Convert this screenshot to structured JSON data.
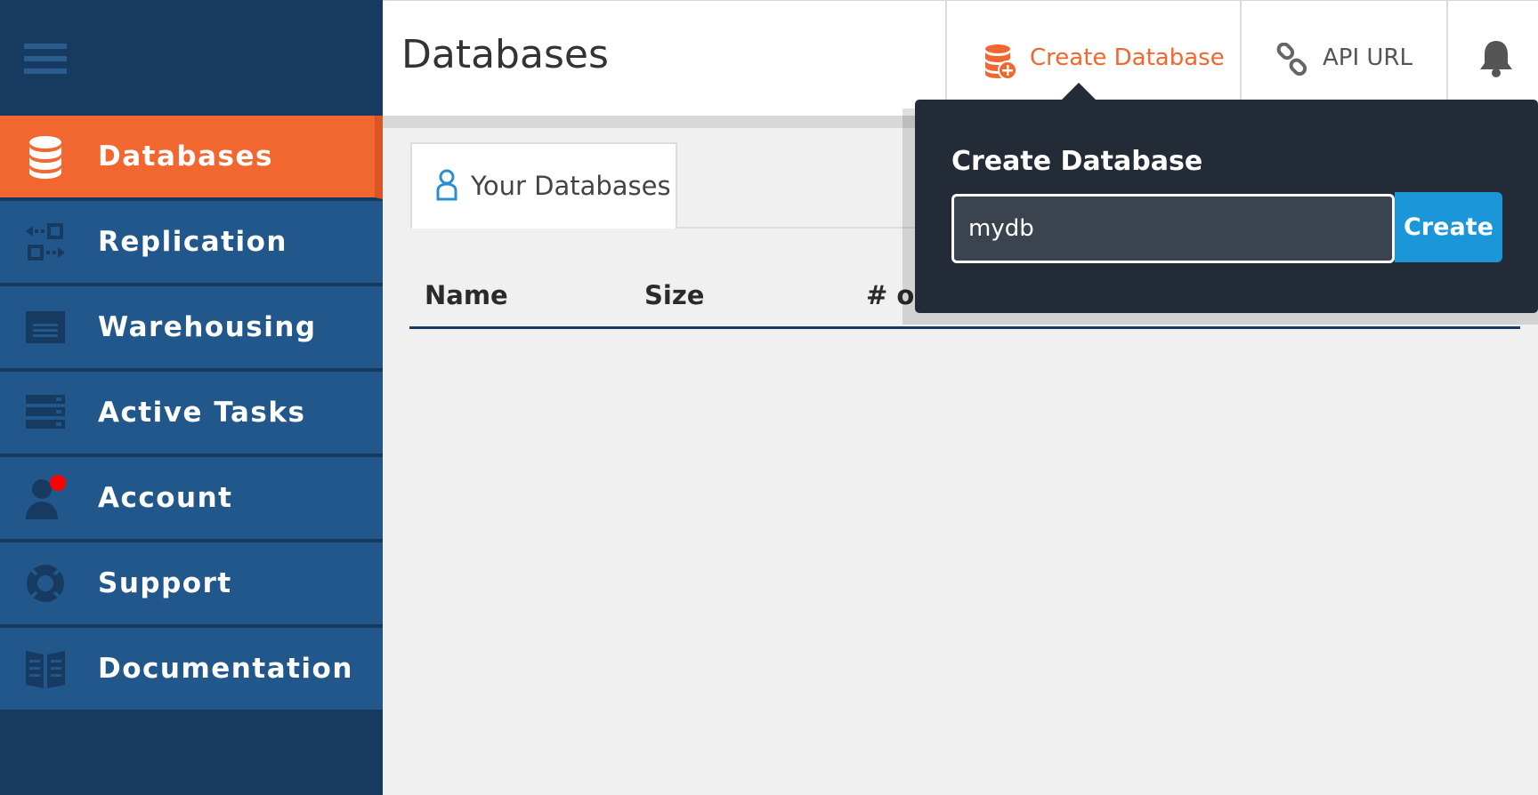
{
  "header": {
    "page_title": "Databases",
    "create_database_label": "Create Database",
    "api_url_label": "API URL"
  },
  "sidebar": {
    "items": [
      {
        "label": "Databases",
        "icon": "database-icon",
        "active": true
      },
      {
        "label": "Replication",
        "icon": "replication-icon"
      },
      {
        "label": "Warehousing",
        "icon": "warehouse-icon"
      },
      {
        "label": "Active Tasks",
        "icon": "tasks-icon"
      },
      {
        "label": "Account",
        "icon": "account-icon",
        "has_notification_dot": true
      },
      {
        "label": "Support",
        "icon": "lifebuoy-icon"
      },
      {
        "label": "Documentation",
        "icon": "book-icon"
      }
    ]
  },
  "main": {
    "tabs": [
      {
        "label": "Your Databases",
        "icon": "user-icon"
      }
    ],
    "table": {
      "columns": [
        "Name",
        "Size",
        "# of"
      ]
    }
  },
  "popover": {
    "title": "Create Database",
    "input_value": "mydb",
    "button_label": "Create"
  },
  "colors": {
    "sidebar_bg": "#173a61",
    "nav_item_bg": "#21578a",
    "active_accent": "#f26630",
    "popover_bg": "#222b36",
    "primary_button": "#1a96d9"
  }
}
